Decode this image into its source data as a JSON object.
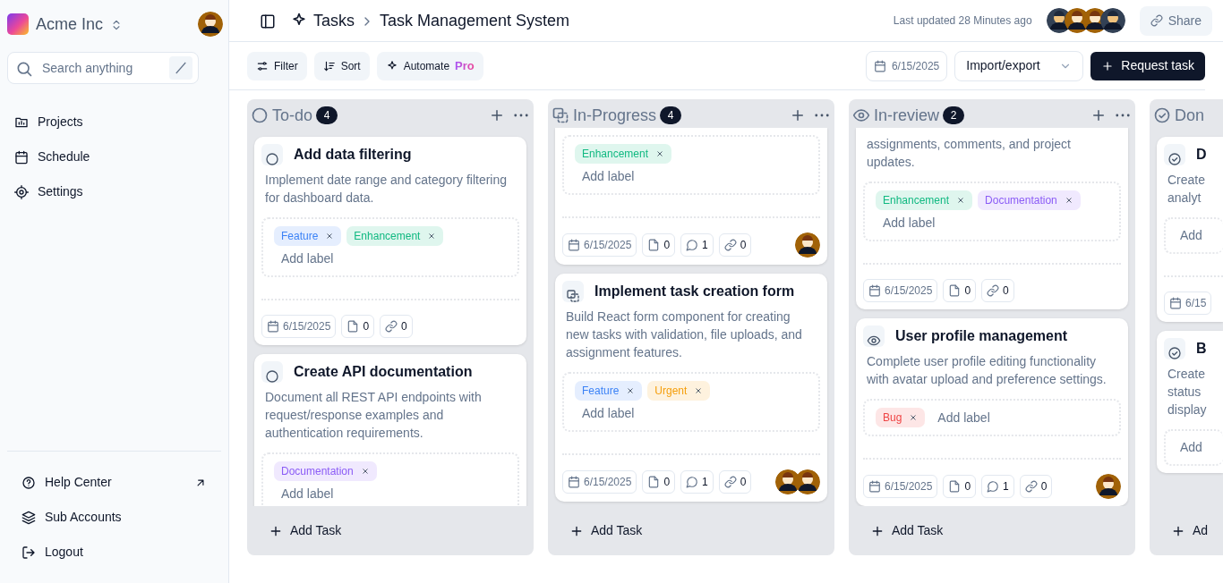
{
  "sidebar": {
    "workspace": "Acme Inc",
    "search": {
      "placeholder": "Search anything"
    },
    "nav": [
      {
        "label": "Projects"
      },
      {
        "label": "Schedule"
      },
      {
        "label": "Settings"
      }
    ],
    "footer_nav": [
      {
        "label": "Help Center"
      },
      {
        "label": "Sub Accounts"
      },
      {
        "label": "Logout"
      }
    ]
  },
  "header": {
    "breadcrumb": [
      "Tasks",
      "Task Management System"
    ],
    "last_updated": "Last updated 28 Minutes ago",
    "collaborators": [
      {
        "kind": "person"
      },
      {
        "kind": "cartoon"
      },
      {
        "kind": "cartoon"
      },
      {
        "kind": "person"
      }
    ],
    "share": "Share"
  },
  "toolbar": {
    "filter": "Filter",
    "sort": "Sort",
    "automate": "Automate",
    "automate_badge": "Pro",
    "date": "6/15/2025",
    "import_export": "Import/export",
    "request": "Request task"
  },
  "columns": [
    {
      "title": "To-do",
      "kind": "todo",
      "count": "4",
      "add_task": "Add Task",
      "cards": [
        {
          "title": "Add data filtering",
          "description": "Implement date range and category filtering for dashboard data.",
          "labels": [
            {
              "text": "Feature",
              "color": "#3b82f6"
            },
            {
              "text": "Enhancement",
              "color": "#10b981"
            }
          ],
          "placeholder": "Add label",
          "date": "6/15/2025",
          "attachments": "0",
          "links": "0"
        },
        {
          "title": "Create API documentation",
          "description": "Document all REST API endpoints with request/response examples and authentication requirements.",
          "labels": [
            {
              "text": "Documentation",
              "color": "#8b5cf6"
            }
          ],
          "placeholder": "Add label"
        }
      ]
    },
    {
      "title": "In-Progress",
      "kind": "progress",
      "count": "4",
      "add_task": "Add Task",
      "cards": [
        {
          "labels": [
            {
              "text": "Enhancement",
              "color": "#10b981"
            }
          ],
          "placeholder": "Add label",
          "date": "6/15/2025",
          "attachments": "0",
          "comments": "1",
          "links": "0",
          "assignees": [
            {
              "kind": "cartoon"
            }
          ]
        },
        {
          "title": "Implement task creation form",
          "description": "Build React form component for creating new tasks with validation, file uploads, and assignment features.",
          "labels": [
            {
              "text": "Feature",
              "color": "#3b82f6"
            },
            {
              "text": "Urgent",
              "color": "#f59e0b"
            }
          ],
          "placeholder": "Add label",
          "date": "6/15/2025",
          "attachments": "0",
          "comments": "1",
          "links": "0",
          "assignees": [
            {
              "kind": "cartoon"
            },
            {
              "kind": "cartoon"
            }
          ]
        }
      ]
    },
    {
      "title": "In-review",
      "kind": "review",
      "count": "2",
      "add_task": "Add Task",
      "cards": [
        {
          "description": "assignments, comments, and project updates.",
          "labels": [
            {
              "text": "Enhancement",
              "color": "#10b981"
            },
            {
              "text": "Documentation",
              "color": "#8b5cf6"
            }
          ],
          "placeholder": "Add label",
          "date": "6/15/2025",
          "attachments": "0",
          "links": "0"
        },
        {
          "title": "User profile management",
          "description": "Complete user profile editing functionality with avatar upload and preference settings.",
          "labels": [
            {
              "text": "Bug",
              "color": "#ef4444"
            }
          ],
          "placeholder": "Add label",
          "date": "6/15/2025",
          "attachments": "0",
          "comments": "1",
          "links": "0",
          "assignees": [
            {
              "kind": "cartoon"
            }
          ]
        }
      ]
    },
    {
      "title": "Don",
      "kind": "done",
      "add_task": "Ad",
      "cards": [
        {
          "title": "D",
          "description": "Create analyt",
          "placeholder": "Add",
          "date": "6/15"
        },
        {
          "title": "B",
          "description": "Create status display",
          "placeholder": "Add"
        }
      ]
    }
  ]
}
